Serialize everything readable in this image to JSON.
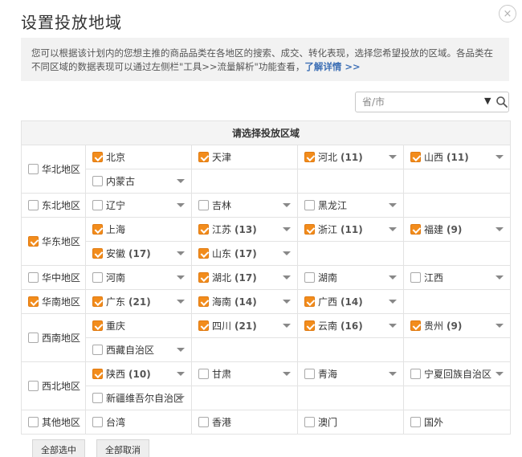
{
  "dialog": {
    "title": "设置投放地域",
    "close_label": "×",
    "description": "您可以根据该计划内的您想主推的商品品类在各地区的搜索、成交、转化表现，选择您希望投放的区域。各品类在不同区域的数据表现可以通过左侧栏\"工具>>流量解析\"功能查看，",
    "description_link": "了解详情 >>"
  },
  "search": {
    "placeholder": "省/市"
  },
  "table": {
    "header": "请选择投放区域",
    "regions": [
      {
        "name": "华北地区",
        "checked": false,
        "rows": [
          [
            {
              "name": "北京",
              "count": "",
              "checked": true,
              "dropdown": false
            },
            {
              "name": "天津",
              "count": "",
              "checked": true,
              "dropdown": false
            },
            {
              "name": "河北",
              "count": "(11)",
              "checked": true,
              "dropdown": true
            },
            {
              "name": "山西",
              "count": "(11)",
              "checked": true,
              "dropdown": true
            }
          ],
          [
            {
              "name": "内蒙古",
              "count": "",
              "checked": false,
              "dropdown": true
            }
          ]
        ]
      },
      {
        "name": "东北地区",
        "checked": false,
        "rows": [
          [
            {
              "name": "辽宁",
              "count": "",
              "checked": false,
              "dropdown": true
            },
            {
              "name": "吉林",
              "count": "",
              "checked": false,
              "dropdown": true
            },
            {
              "name": "黑龙江",
              "count": "",
              "checked": false,
              "dropdown": true
            }
          ]
        ]
      },
      {
        "name": "华东地区",
        "checked": true,
        "rows": [
          [
            {
              "name": "上海",
              "count": "",
              "checked": true,
              "dropdown": false
            },
            {
              "name": "江苏",
              "count": "(13)",
              "checked": true,
              "dropdown": true
            },
            {
              "name": "浙江",
              "count": "(11)",
              "checked": true,
              "dropdown": true
            },
            {
              "name": "福建",
              "count": "(9)",
              "checked": true,
              "dropdown": true
            }
          ],
          [
            {
              "name": "安徽",
              "count": "(17)",
              "checked": true,
              "dropdown": true
            },
            {
              "name": "山东",
              "count": "(17)",
              "checked": true,
              "dropdown": true
            }
          ]
        ]
      },
      {
        "name": "华中地区",
        "checked": false,
        "rows": [
          [
            {
              "name": "河南",
              "count": "",
              "checked": false,
              "dropdown": true
            },
            {
              "name": "湖北",
              "count": "(17)",
              "checked": true,
              "dropdown": true
            },
            {
              "name": "湖南",
              "count": "",
              "checked": false,
              "dropdown": true
            },
            {
              "name": "江西",
              "count": "",
              "checked": false,
              "dropdown": true
            }
          ]
        ]
      },
      {
        "name": "华南地区",
        "checked": true,
        "rows": [
          [
            {
              "name": "广东",
              "count": "(21)",
              "checked": true,
              "dropdown": true
            },
            {
              "name": "海南",
              "count": "(14)",
              "checked": true,
              "dropdown": true
            },
            {
              "name": "广西",
              "count": "(14)",
              "checked": true,
              "dropdown": true
            }
          ]
        ]
      },
      {
        "name": "西南地区",
        "checked": false,
        "rows": [
          [
            {
              "name": "重庆",
              "count": "",
              "checked": true,
              "dropdown": false
            },
            {
              "name": "四川",
              "count": "(21)",
              "checked": true,
              "dropdown": true
            },
            {
              "name": "云南",
              "count": "(16)",
              "checked": true,
              "dropdown": true
            },
            {
              "name": "贵州",
              "count": "(9)",
              "checked": true,
              "dropdown": true
            }
          ],
          [
            {
              "name": "西藏自治区",
              "count": "",
              "checked": false,
              "dropdown": true
            }
          ]
        ]
      },
      {
        "name": "西北地区",
        "checked": false,
        "rows": [
          [
            {
              "name": "陕西",
              "count": "(10)",
              "checked": true,
              "dropdown": true
            },
            {
              "name": "甘肃",
              "count": "",
              "checked": false,
              "dropdown": true
            },
            {
              "name": "青海",
              "count": "",
              "checked": false,
              "dropdown": true
            },
            {
              "name": "宁夏回族自治区",
              "count": "",
              "checked": false,
              "dropdown": true
            }
          ],
          [
            {
              "name": "新疆维吾尔自治区",
              "count": "",
              "checked": false,
              "dropdown": true
            }
          ]
        ]
      },
      {
        "name": "其他地区",
        "checked": false,
        "rows": [
          [
            {
              "name": "台湾",
              "count": "",
              "checked": false,
              "dropdown": false
            },
            {
              "name": "香港",
              "count": "",
              "checked": false,
              "dropdown": false
            },
            {
              "name": "澳门",
              "count": "",
              "checked": false,
              "dropdown": false
            },
            {
              "name": "国外",
              "count": "",
              "checked": false,
              "dropdown": false
            }
          ]
        ]
      }
    ]
  },
  "footer": {
    "select_all_label": "全部选中",
    "deselect_all_label": "全部取消"
  },
  "colors": {
    "accent": "#f28c1c",
    "link": "#3d6fb5",
    "description_bg": "#f2f2f2"
  },
  "icons": {
    "close": "close-icon",
    "search": "search-icon",
    "dropdown": "chevron-down-icon"
  }
}
